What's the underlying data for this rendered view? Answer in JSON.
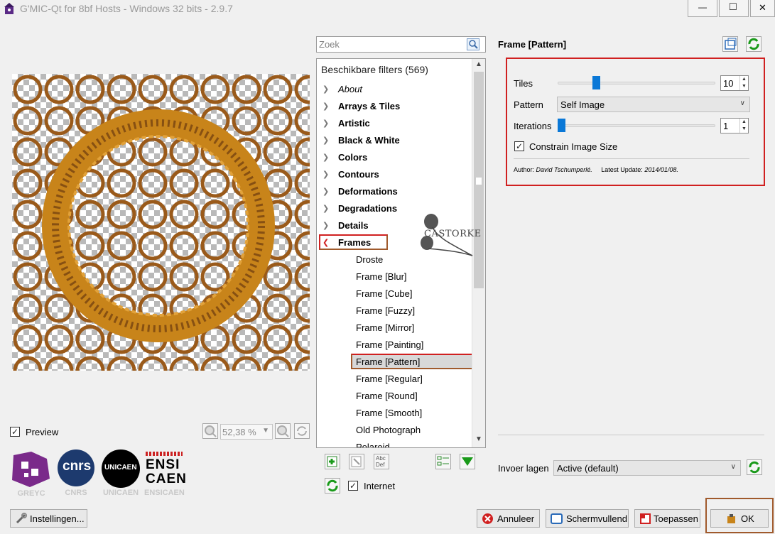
{
  "window": {
    "title": "G'MIC-Qt for 8bf Hosts - Windows 32 bits - 2.9.7",
    "min_glyph": "—",
    "max_glyph": "□",
    "close_glyph": "✕"
  },
  "preview": {
    "label": "Preview",
    "checked_glyph": "✓",
    "zoom_value": "52,38 %"
  },
  "watermark": {
    "text": "CASTORKE"
  },
  "logos": [
    {
      "name": "GREYC"
    },
    {
      "name": "CNRS",
      "mark": "cnrs"
    },
    {
      "name": "UNICAEN",
      "mark": "UNICAEN"
    },
    {
      "name": "ENSICAEN",
      "mark_top": "ENSI",
      "mark_bottom": "CAEN"
    }
  ],
  "settings_button": {
    "label": "Instellingen..."
  },
  "search": {
    "placeholder": "Zoek",
    "value": ""
  },
  "filter_tree": {
    "header": "Beschikbare filters (569)",
    "categories": [
      {
        "label": "About",
        "italic": true
      },
      {
        "label": "Arrays & Tiles"
      },
      {
        "label": "Artistic"
      },
      {
        "label": "Black & White"
      },
      {
        "label": "Colors"
      },
      {
        "label": "Contours"
      },
      {
        "label": "Deformations"
      },
      {
        "label": "Degradations"
      },
      {
        "label": "Details"
      },
      {
        "label": "Frames",
        "expanded": true
      }
    ],
    "frames_children": [
      "Droste",
      "Frame [Blur]",
      "Frame [Cube]",
      "Frame [Fuzzy]",
      "Frame [Mirror]",
      "Frame [Painting]",
      "Frame [Pattern]",
      "Frame [Regular]",
      "Frame [Round]",
      "Frame [Smooth]",
      "Old Photograph",
      "Polaroid"
    ],
    "selected": "Frame [Pattern]"
  },
  "tree_tools": {
    "internet_label": "Internet",
    "internet_checked": true,
    "abc_top": "Abc",
    "abc_bottom": "Def"
  },
  "params": {
    "title": "Frame [Pattern]",
    "tiles": {
      "label": "Tiles",
      "value": "10",
      "min": 1,
      "max": 40
    },
    "pattern": {
      "label": "Pattern",
      "value": "Self Image"
    },
    "iterations": {
      "label": "Iterations",
      "value": "1",
      "min": 1,
      "max": 10
    },
    "constrain": {
      "label": "Constrain Image Size",
      "checked": true
    },
    "author_label": "Author:",
    "author_value": "David Tschumperlé.",
    "update_label": "Latest Update:",
    "update_value": "2014/01/08."
  },
  "input_layers": {
    "label": "Invoer lagen",
    "value": "Active (default)"
  },
  "buttons": {
    "cancel": "Annuleer",
    "fullscreen": "Schermvullend",
    "apply": "Toepassen",
    "ok": "OK"
  },
  "colors": {
    "accent_blue": "#0a78d7",
    "highlight_red": "#d02020",
    "highlight_brown": "#a05a2c",
    "frame_gold": "#c8841a"
  }
}
